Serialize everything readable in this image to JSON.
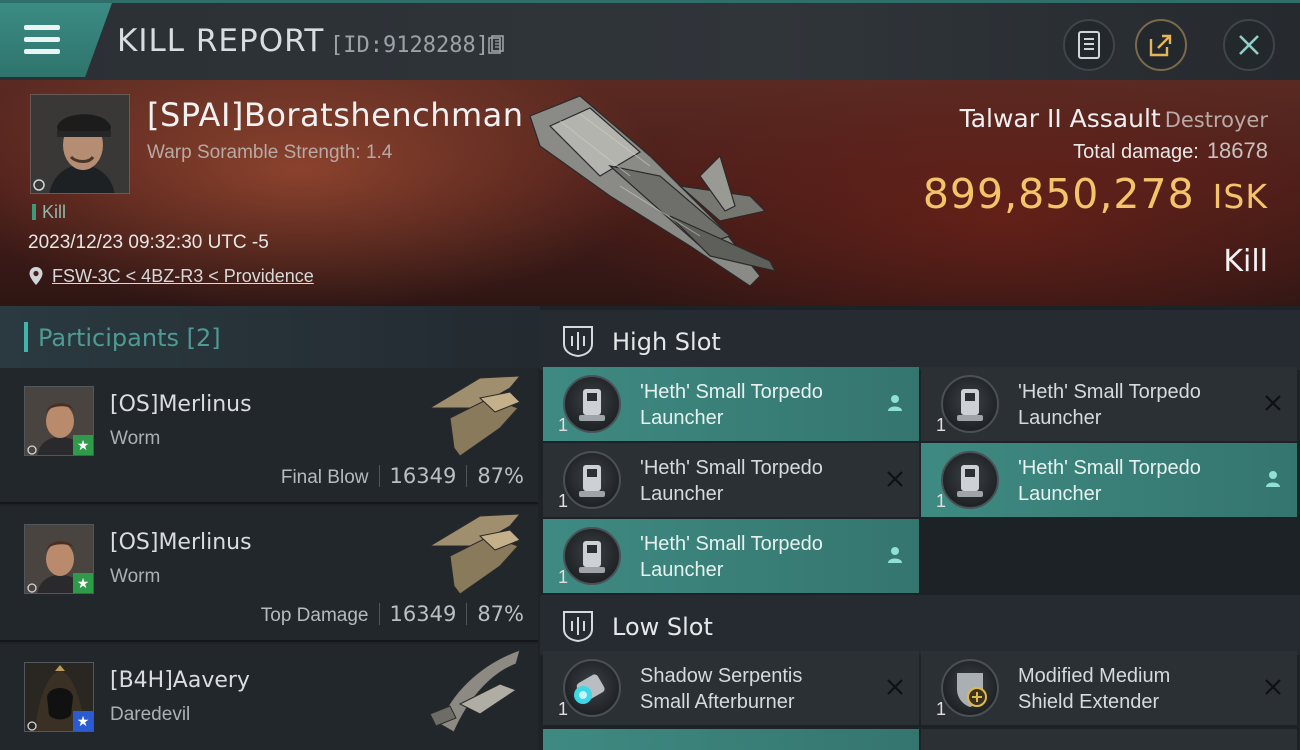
{
  "header": {
    "title": "KILL REPORT",
    "id_text": "[ID:9128288]"
  },
  "victim": {
    "name": "[SPAI]Boratshenchman",
    "subtitle": "Warp Soramble Strength: 1.4",
    "kill_tag": "Kill",
    "time": "2023/12/23 09:32:30 UTC -5",
    "location": "FSW-3C < 4BZ-R3 < Providence",
    "ship_name": "Talwar II Assault",
    "ship_class": "Destroyer",
    "total_damage_label": "Total damage:",
    "total_damage_value": "18678",
    "isk_value": "899,850,278",
    "isk_unit": "ISK",
    "result": "Kill"
  },
  "participants": {
    "title": "Participants",
    "count": "[2]",
    "items": [
      {
        "name": "[OS]Merlinus",
        "ship": "Worm",
        "label": "Final Blow",
        "damage": "16349",
        "percent": "87%",
        "badge_color": "#2e9a4a"
      },
      {
        "name": "[OS]Merlinus",
        "ship": "Worm",
        "label": "Top Damage",
        "damage": "16349",
        "percent": "87%",
        "badge_color": "#2e9a4a"
      },
      {
        "name": "[B4H]Aavery",
        "ship": "Daredevil",
        "badge_color": "#2a5bd0"
      }
    ]
  },
  "slots": {
    "high": {
      "title": "High Slot",
      "modules": [
        {
          "qty": "1",
          "line1": "'Heth' Small Torpedo",
          "line2": "Launcher",
          "state": "user-icon",
          "active": true
        },
        {
          "qty": "1",
          "line1": "'Heth' Small Torpedo",
          "line2": "Launcher",
          "state": "close-icon",
          "active": false
        },
        {
          "qty": "1",
          "line1": "'Heth' Small Torpedo",
          "line2": "Launcher",
          "state": "close-icon",
          "active": false
        },
        {
          "qty": "1",
          "line1": "'Heth' Small Torpedo",
          "line2": "Launcher",
          "state": "user-icon",
          "active": true
        },
        {
          "qty": "1",
          "line1": "'Heth' Small Torpedo",
          "line2": "Launcher",
          "state": "user-icon",
          "active": true
        }
      ]
    },
    "low": {
      "title": "Low Slot",
      "modules": [
        {
          "qty": "1",
          "line1": "Shadow Serpentis",
          "line2": "Small Afterburner",
          "state": "close-icon",
          "active": false
        },
        {
          "qty": "1",
          "line1": "Modified Medium",
          "line2": "Shield Extender",
          "state": "close-icon",
          "active": false
        }
      ]
    }
  },
  "colors": {
    "accent": "#3fb6ac",
    "isk": "#f4c46a",
    "active_module": "#3e8a82"
  }
}
